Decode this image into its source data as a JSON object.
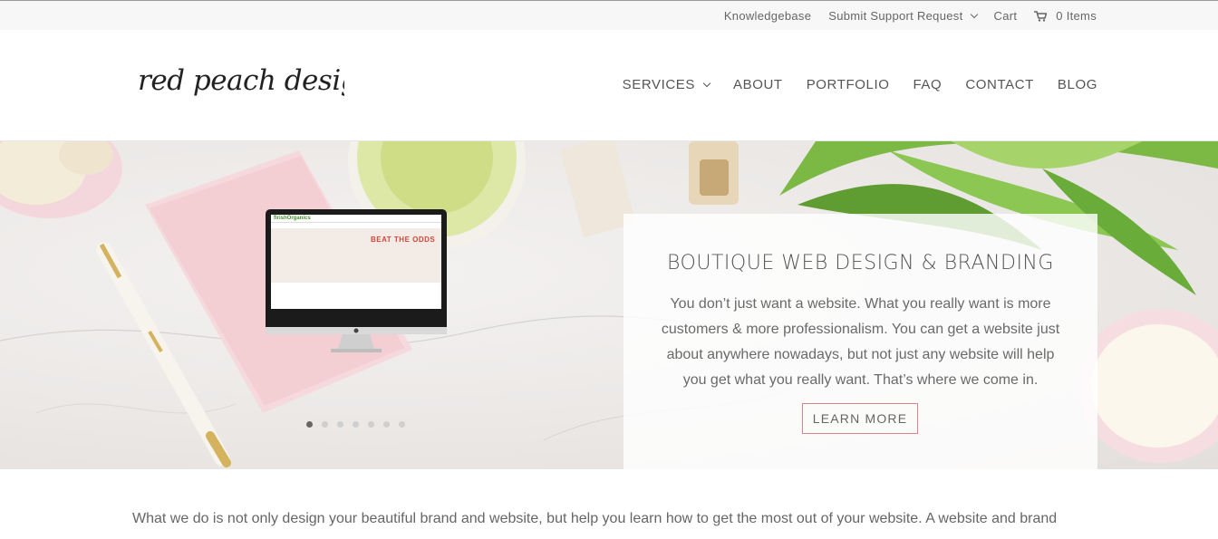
{
  "topbar": {
    "knowledgebase": "Knowledgebase",
    "support": "Submit Support Request",
    "cart": "Cart",
    "items": "0 Items"
  },
  "header": {
    "logo_text": "red peach designs",
    "nav": {
      "services": "SERVICES",
      "about": "ABOUT",
      "portfolio": "PORTFOLIO",
      "faq": "FAQ",
      "contact": "CONTACT",
      "blog": "BLOG"
    }
  },
  "hero": {
    "monitor_site_name": "flrishOrganics",
    "monitor_headline": "BEAT THE ODDS",
    "title": "BOUTIQUE WEB DESIGN & BRANDING",
    "text": "You don’t just want a website. What you really want is more customers & more professionalism. You can get a website just about anywhere nowadays, but not just any website will help you get what you really want. That’s where we come in.",
    "button": "LEARN MORE",
    "slides_total": 7,
    "slide_active": 1
  },
  "intro": {
    "text": "What we do is not only design your beautiful brand and website, but help you learn how to get the most out of your website. A website and brand"
  },
  "colors": {
    "accent": "#d9838a",
    "pink": "#f4d7dc",
    "leaf": "#6fae3a"
  }
}
